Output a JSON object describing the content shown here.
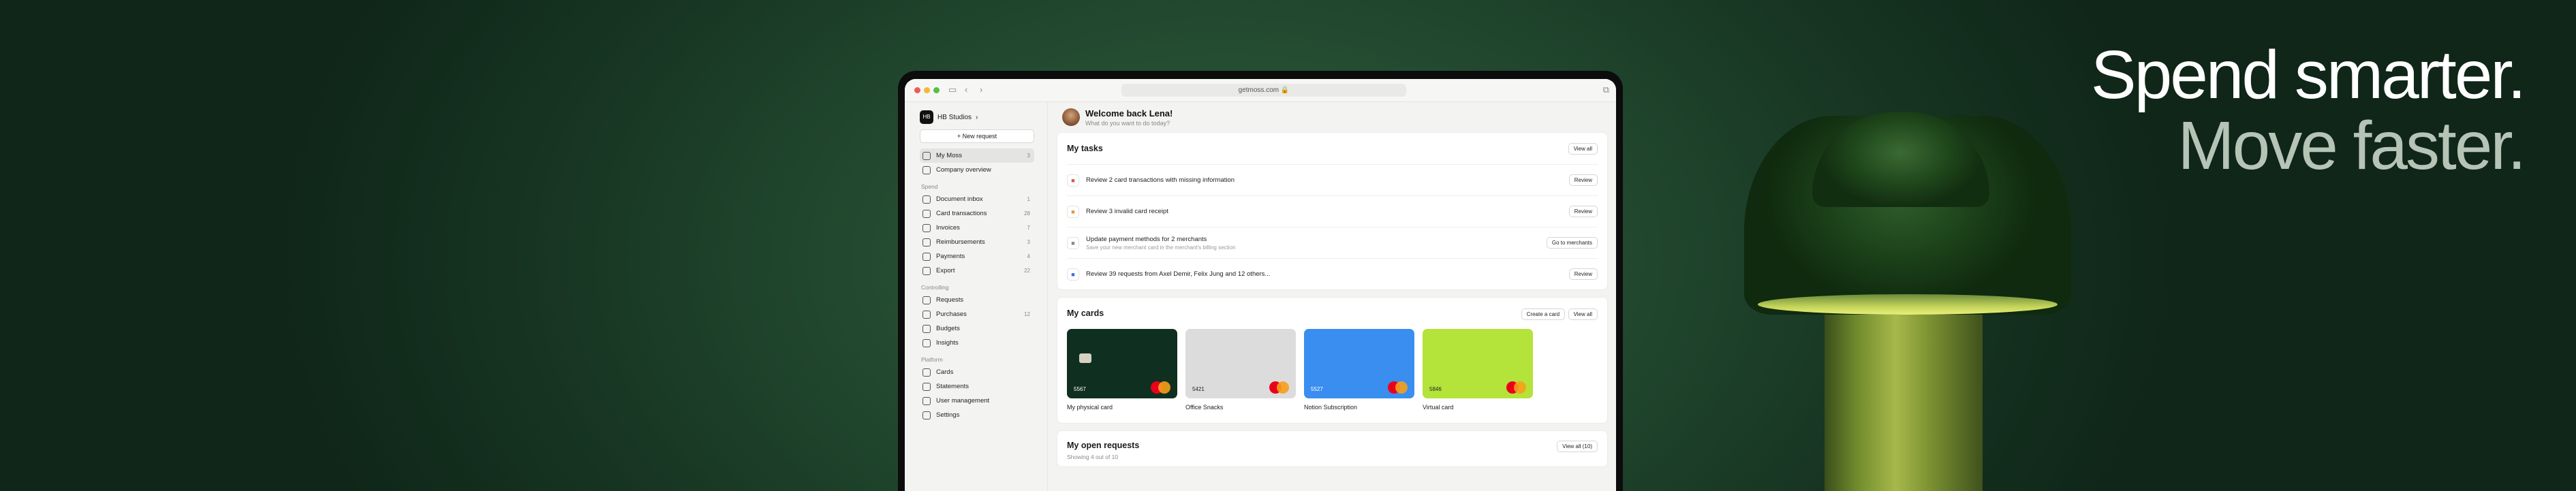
{
  "hero": {
    "line1": "Spend smarter.",
    "line2": "Move faster."
  },
  "browser": {
    "url": "getmoss.com"
  },
  "org": {
    "name": "HB Studios",
    "logo": "HB"
  },
  "sidebar": {
    "new_request": "+ New request",
    "top": [
      {
        "label": "My Moss",
        "count": "3",
        "icon": "home-icon"
      },
      {
        "label": "Company overview",
        "count": "",
        "icon": "building-icon"
      }
    ],
    "spend_title": "Spend",
    "spend": [
      {
        "label": "Document inbox",
        "count": "1",
        "icon": "inbox-icon"
      },
      {
        "label": "Card transactions",
        "count": "28",
        "icon": "card-icon"
      },
      {
        "label": "Invoices",
        "count": "7",
        "icon": "invoice-icon"
      },
      {
        "label": "Reimbursements",
        "count": "3",
        "icon": "receipt-icon"
      },
      {
        "label": "Payments",
        "count": "4",
        "icon": "payment-icon"
      },
      {
        "label": "Export",
        "count": "22",
        "icon": "export-icon"
      }
    ],
    "controlling_title": "Controlling",
    "controlling": [
      {
        "label": "Requests",
        "count": "",
        "icon": "request-icon"
      },
      {
        "label": "Purchases",
        "count": "12",
        "icon": "cart-icon"
      },
      {
        "label": "Budgets",
        "count": "",
        "icon": "budget-icon"
      },
      {
        "label": "Insights",
        "count": "",
        "icon": "chart-icon"
      }
    ],
    "platform_title": "Platform",
    "platform": [
      {
        "label": "Cards",
        "count": "",
        "icon": "card-icon"
      },
      {
        "label": "Statements",
        "count": "",
        "icon": "document-icon"
      },
      {
        "label": "User management",
        "count": "",
        "icon": "user-icon"
      },
      {
        "label": "Settings",
        "count": "",
        "icon": "gear-icon"
      }
    ]
  },
  "welcome": {
    "title": "Welcome back Lena!",
    "subtitle": "What do you want to do today?"
  },
  "tasks": {
    "title": "My tasks",
    "view_all": "View all",
    "items": [
      {
        "title": "Review 2 card transactions with missing information",
        "sub": "",
        "action": "Review",
        "icon": "document-icon",
        "color": "#e0563b"
      },
      {
        "title": "Review 3 invalid card receipt",
        "sub": "",
        "action": "Review",
        "icon": "receipt-icon",
        "color": "#e8943b"
      },
      {
        "title": "Update payment methods for 2 merchants",
        "sub": "Save your new merchant card in the merchant's billing section",
        "action": "Go to merchants",
        "icon": "card-icon",
        "color": "#888888"
      },
      {
        "title": "Review 39 requests from Axel Demir, Felix Jung and 12 others...",
        "sub": "",
        "action": "Review",
        "icon": "user-icon",
        "color": "#3b6fe0"
      }
    ]
  },
  "cards": {
    "title": "My cards",
    "create": "Create a card",
    "view_all": "View all",
    "items": [
      {
        "name": "My physical card",
        "last4": "5567",
        "color": "#0f3020",
        "text": "#ffffff",
        "brand": "mastercard"
      },
      {
        "name": "Office Snacks",
        "last4": "5421",
        "color": "#dcdcdc",
        "text": "#222222",
        "brand": "mastercard"
      },
      {
        "name": "Notion Subscription",
        "last4": "5527",
        "color": "#3a8ef0",
        "text": "#ffffff",
        "brand": "mastercard"
      },
      {
        "name": "Virtual card",
        "last4": "5846",
        "color": "#b4e33a",
        "text": "#222222",
        "brand": "mastercard"
      }
    ]
  },
  "open_requests": {
    "title": "My open requests",
    "subtitle": "Showing 4 out of 10",
    "view_all": "View all (10)"
  }
}
